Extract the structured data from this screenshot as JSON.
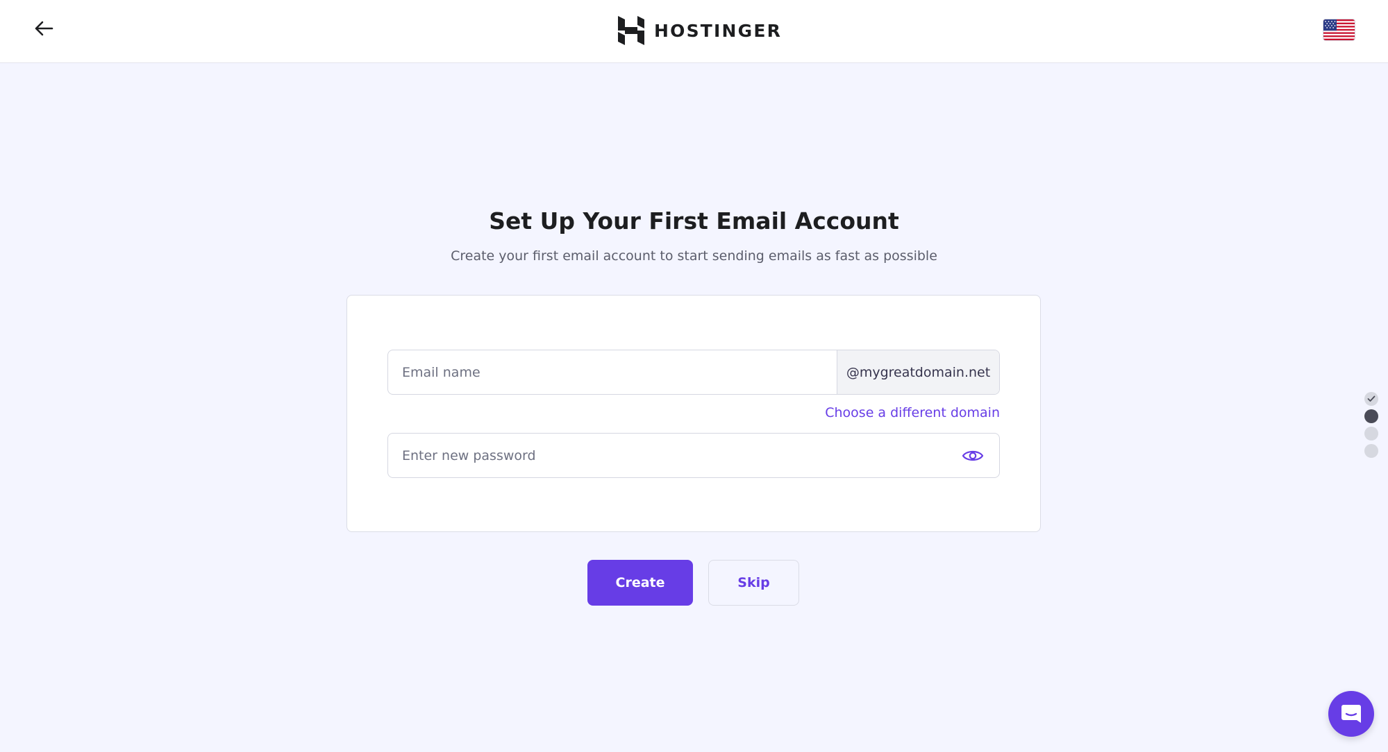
{
  "header": {
    "brand_name": "HOSTINGER",
    "back_label": "Back",
    "language": "English (US)"
  },
  "page": {
    "title": "Set Up Your First Email Account",
    "subtitle": "Create your first email account to start sending emails as fast as possible"
  },
  "form": {
    "email_placeholder": "Email name",
    "domain_suffix": "@mygreatdomain.net",
    "change_domain_label": "Choose a different domain",
    "password_placeholder": "Enter new password"
  },
  "actions": {
    "create_label": "Create",
    "skip_label": "Skip"
  },
  "steps": {
    "total": 4,
    "completed": 1,
    "current": 2
  },
  "colors": {
    "accent": "#673de6",
    "background": "#f4f5ff",
    "text_dark": "#1d1e20"
  },
  "icons": {
    "back": "arrow-left-icon",
    "brand": "hostinger-logo",
    "language": "us-flag-icon",
    "password_toggle": "eye-icon",
    "step_done": "check-icon",
    "chat": "chat-icon"
  }
}
